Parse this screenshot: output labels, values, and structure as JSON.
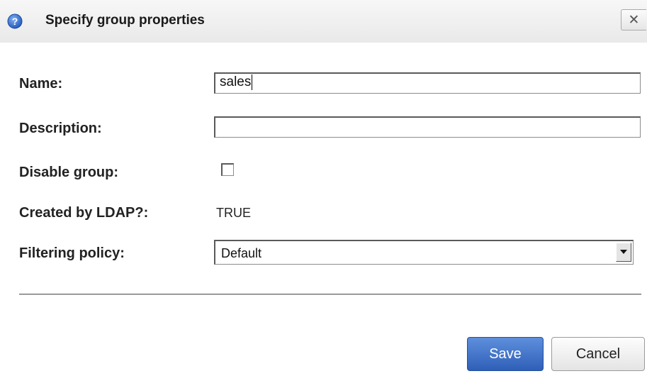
{
  "dialog": {
    "title": "Specify group properties",
    "close_label": "✕"
  },
  "form": {
    "name_label": "Name:",
    "name_value": "sales",
    "description_label": "Description:",
    "description_value": "",
    "disable_label": "Disable group:",
    "disable_checked": false,
    "ldap_label": "Created by LDAP?:",
    "ldap_value": "TRUE",
    "filtering_label": "Filtering policy:",
    "filtering_value": "Default"
  },
  "buttons": {
    "save_label": "Save",
    "cancel_label": "Cancel"
  },
  "colors": {
    "primary_button": "#3a6cc6",
    "help_icon": "#2a63c4"
  }
}
